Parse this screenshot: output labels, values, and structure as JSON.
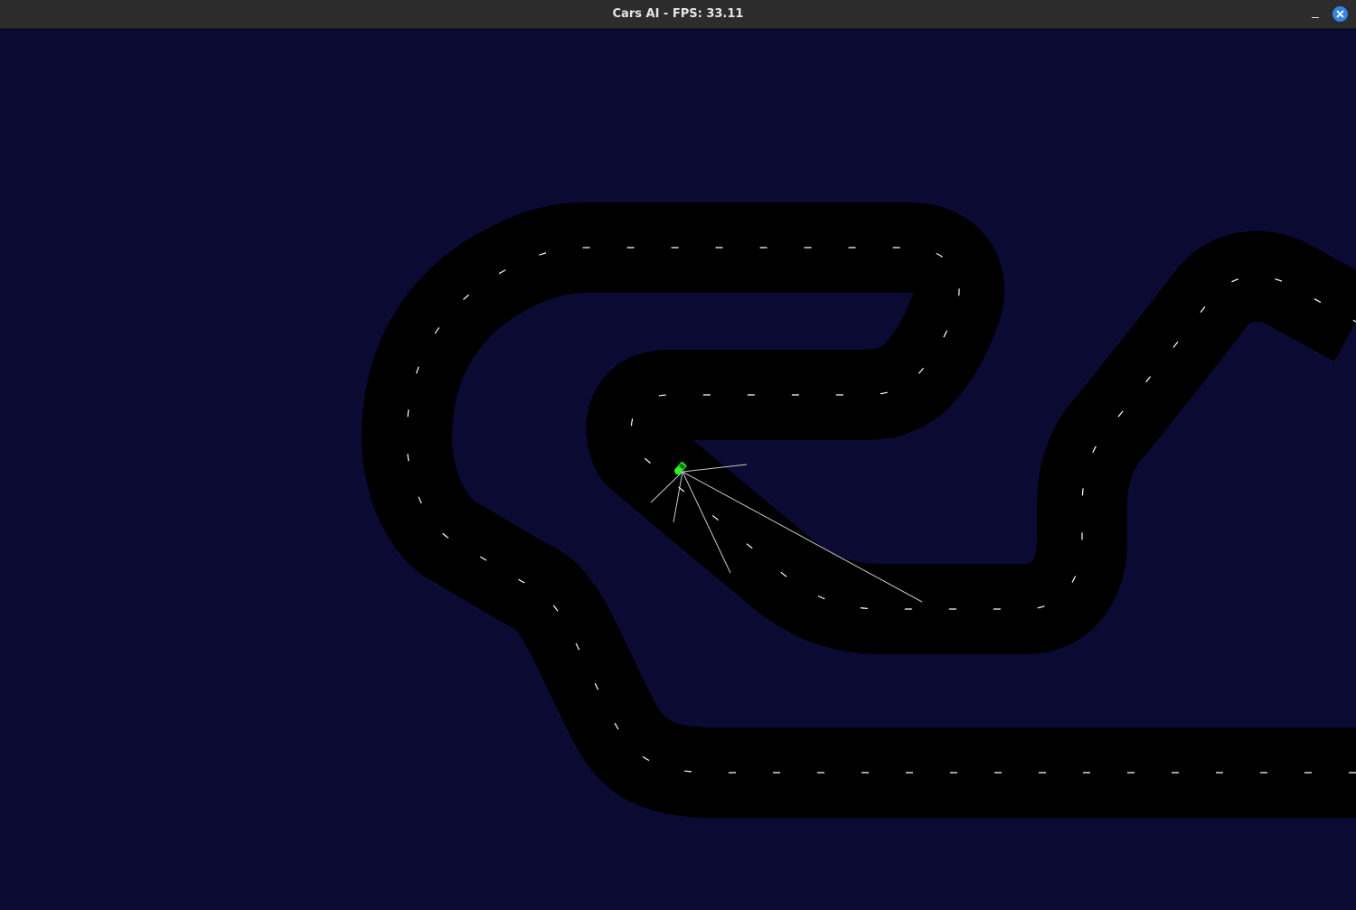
{
  "window": {
    "title": "Cars AI - FPS: 33.11"
  },
  "colors": {
    "background": "#0b0a33",
    "track": "#000000",
    "lane_marks": "#ffffff",
    "car": "#22dd22",
    "sensors": "#c8c8c8",
    "titlebar": "#2c2c2c",
    "close_button": "#3584e4"
  },
  "icons": {
    "minimize": "minimize-icon",
    "close": "close-icon"
  },
  "game": {
    "sensor_count": 5
  }
}
